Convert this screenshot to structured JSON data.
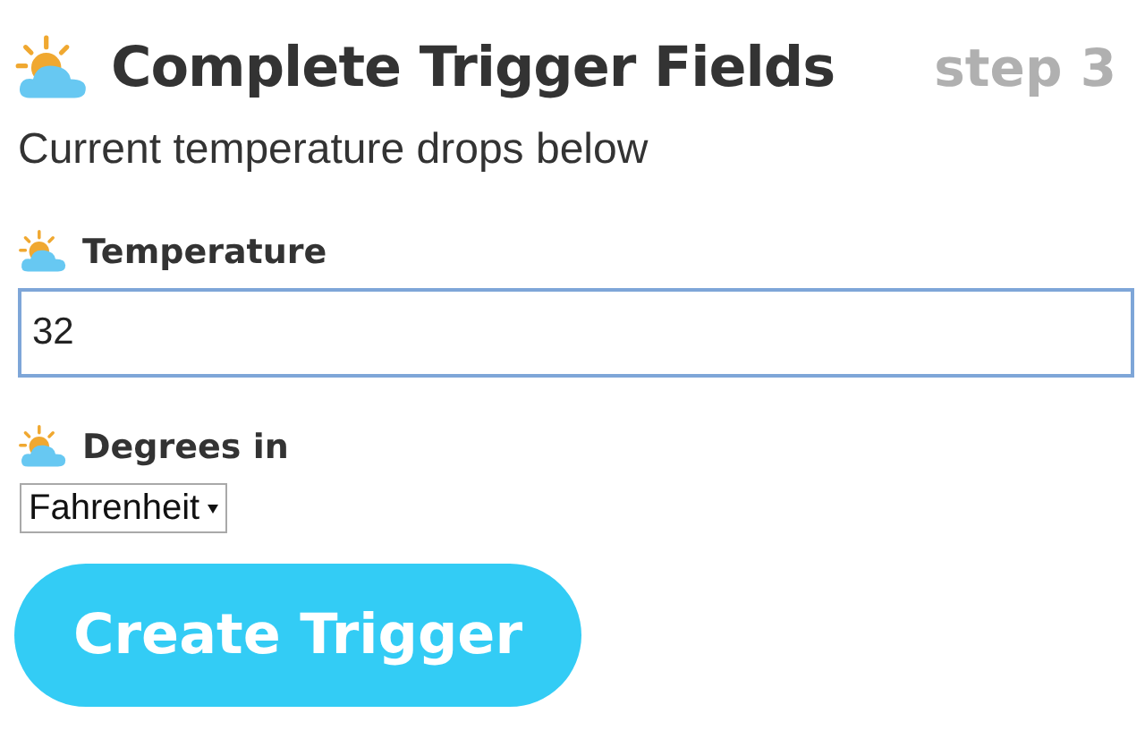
{
  "header": {
    "title": "Complete Trigger Fields",
    "step": "step 3"
  },
  "description": "Current temperature drops below",
  "fields": [
    {
      "kind": "text",
      "label": "Temperature",
      "value": "32"
    },
    {
      "kind": "select",
      "label": "Degrees in",
      "value": "Fahrenheit"
    }
  ],
  "submit_button": "Create Trigger"
}
